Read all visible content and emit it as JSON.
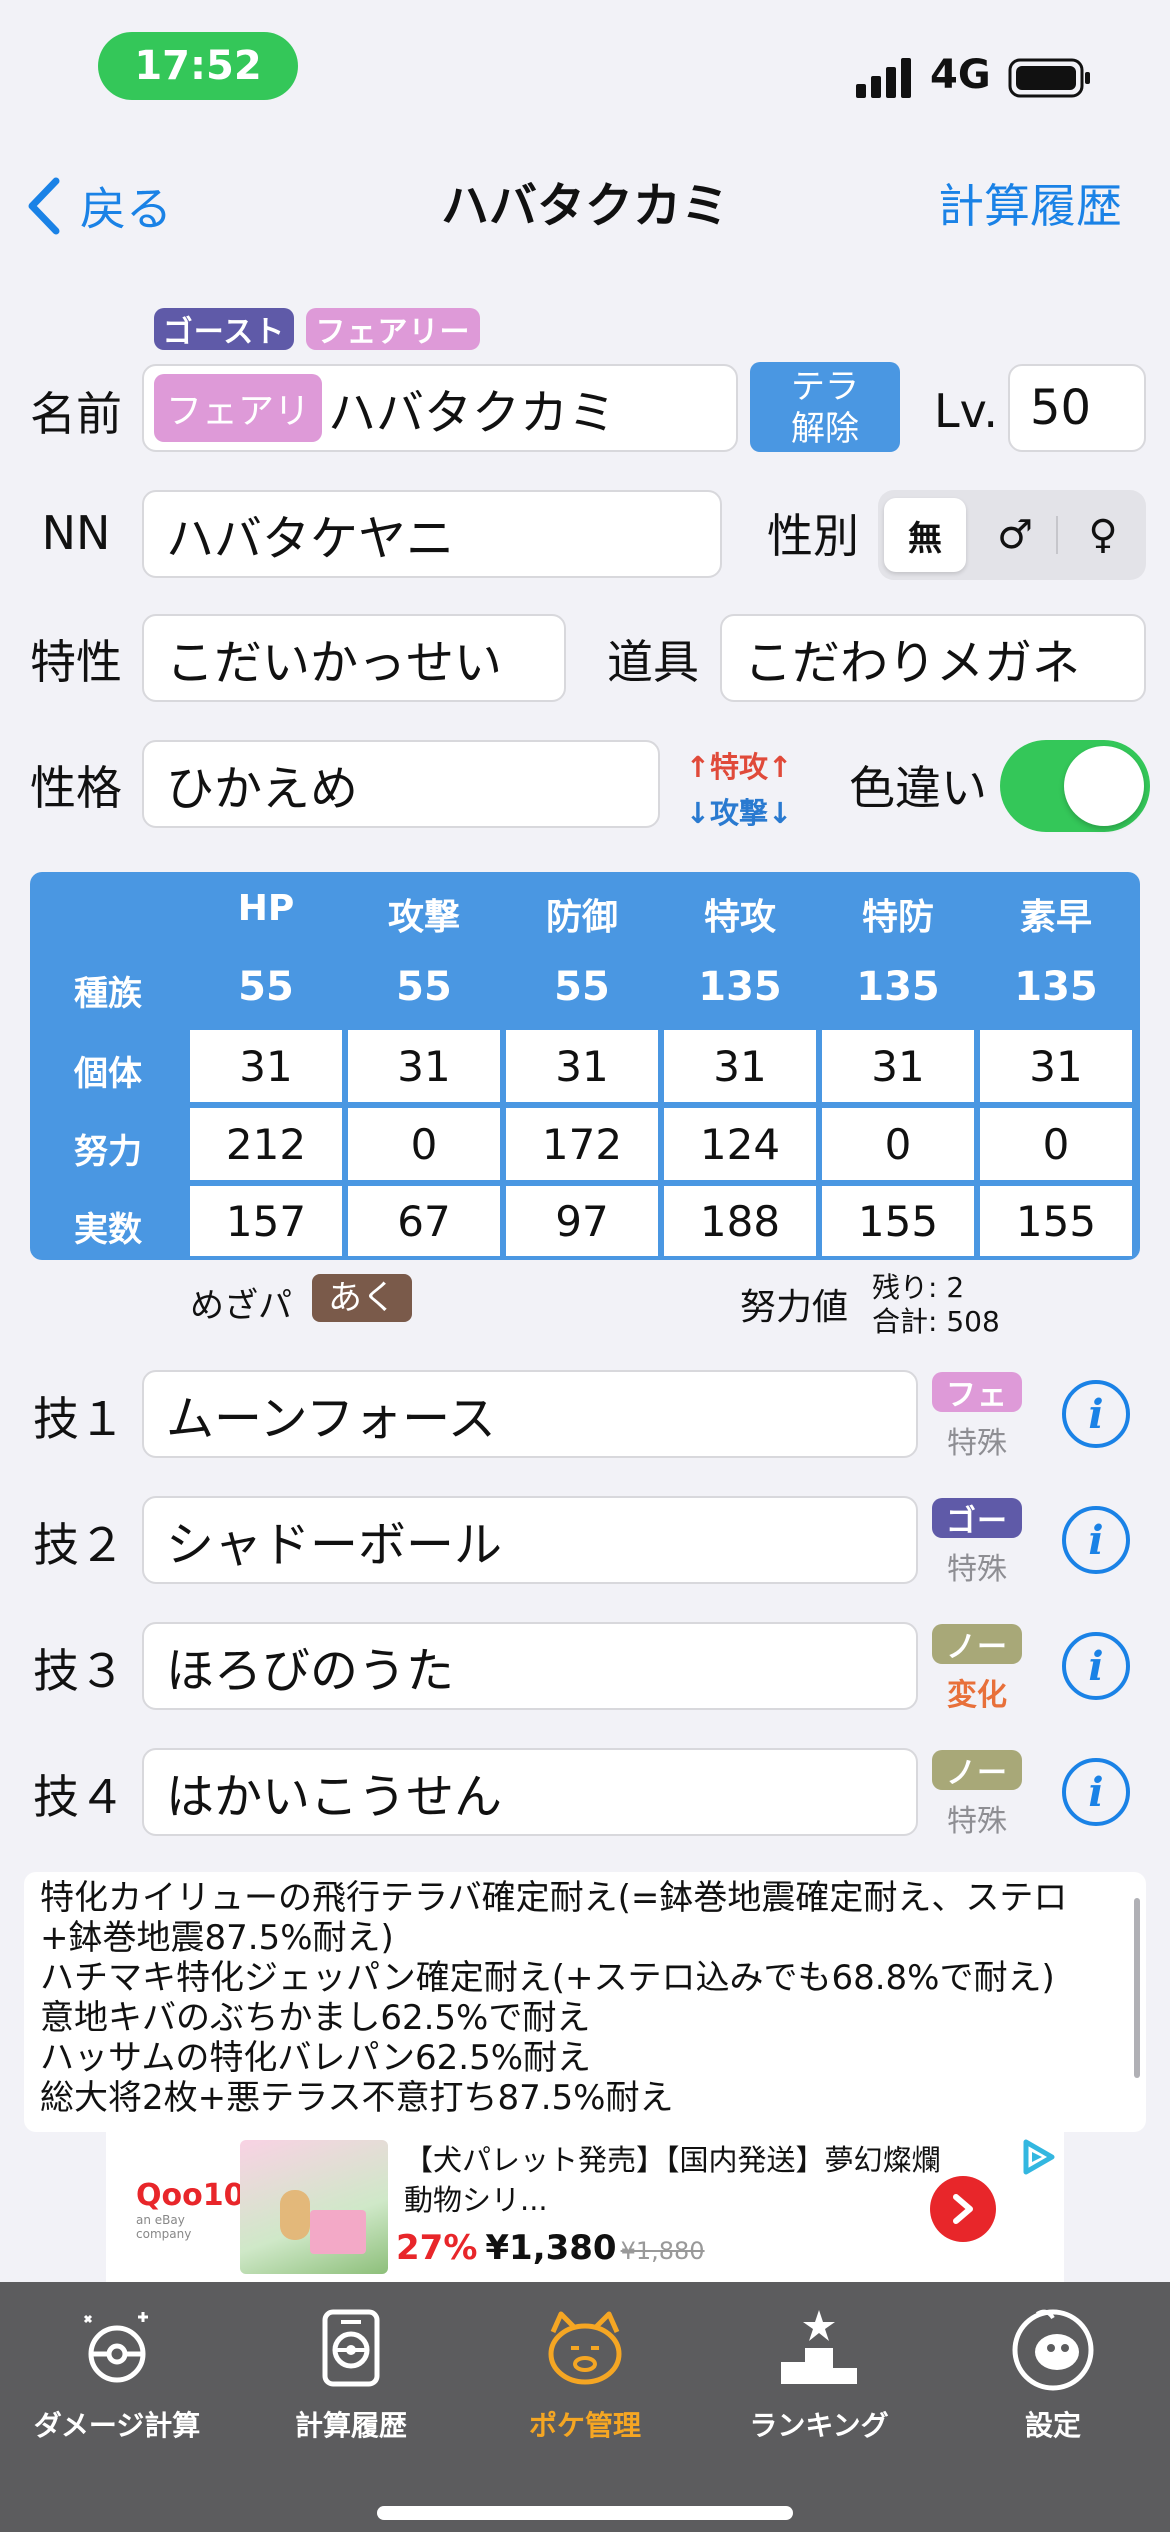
{
  "status_bar": {
    "time": "17:52",
    "network": "4G"
  },
  "nav": {
    "back_label": "戻る",
    "title": "ハバタクカミ",
    "right_label": "計算履歴"
  },
  "types": [
    {
      "name": "ゴースト",
      "color": "#5f5aa8"
    },
    {
      "name": "フェアリー",
      "color": "#de9ad8"
    }
  ],
  "form": {
    "name_label": "名前",
    "tera_badge": "フェアリ",
    "name_value": "ハバタクカミ",
    "tera_button_line1": "テラ",
    "tera_button_line2": "解除",
    "level_label": "Lv.",
    "level_value": "50",
    "nickname_label": "NN",
    "nickname_value": "ハバタケヤニ",
    "gender_label": "性別",
    "gender_options": [
      "無",
      "♂",
      "♀"
    ],
    "gender_selected": "無",
    "ability_label": "特性",
    "ability_value": "こだいかっせい",
    "item_label": "道具",
    "item_value": "こだわりメガネ",
    "nature_label": "性格",
    "nature_value": "ひかえめ",
    "nature_up": "↑特攻↑",
    "nature_down": "↓攻撃↓",
    "shiny_label": "色違い",
    "shiny_on": true
  },
  "stats": {
    "columns": [
      "HP",
      "攻撃",
      "防御",
      "特攻",
      "特防",
      "素早"
    ],
    "rows": [
      {
        "label": "種族",
        "values": [
          "55",
          "55",
          "55",
          "135",
          "135",
          "135"
        ]
      },
      {
        "label": "個体",
        "values": [
          "31",
          "31",
          "31",
          "31",
          "31",
          "31"
        ]
      },
      {
        "label": "努力",
        "values": [
          "212",
          "0",
          "172",
          "124",
          "0",
          "0"
        ]
      },
      {
        "label": "実数",
        "values": [
          "157",
          "67",
          "97",
          "188",
          "155",
          "155"
        ]
      }
    ]
  },
  "hidden_power": {
    "label": "めざパ",
    "type": "あく",
    "color": "#7a5a4a"
  },
  "ev_summary": {
    "label": "努力値",
    "remaining": "残り: 2",
    "total": "合計: 508"
  },
  "moves": [
    {
      "label": "技１",
      "name": "ムーンフォース",
      "type": "フェ",
      "type_color": "#de9ad8",
      "category": "特殊",
      "category_color": "#8e8e93"
    },
    {
      "label": "技２",
      "name": "シャドーボール",
      "type": "ゴー",
      "type_color": "#5f5aa8",
      "category": "特殊",
      "category_color": "#8e8e93"
    },
    {
      "label": "技３",
      "name": "ほろびのうた",
      "type": "ノー",
      "type_color": "#a8a878",
      "category": "変化",
      "category_color": "#e8703a"
    },
    {
      "label": "技４",
      "name": "はかいこうせん",
      "type": "ノー",
      "type_color": "#a8a878",
      "category": "特殊",
      "category_color": "#8e8e93"
    }
  ],
  "memo_lines": [
    "特化カイリューの飛行テラバ確定耐え(=鉢巻地震確定耐え、ステロ",
    "+鉢巻地震87.5%耐え)",
    "ハチマキ特化ジェッパン確定耐え(+ステロ込みでも68.8%で耐え)",
    "意地キバのぶちかまし62.5%で耐え",
    "ハッサムの特化バレパン62.5%耐え",
    "総大将2枚+悪テラス不意打ち87.5%耐え"
  ],
  "ad": {
    "brand": "Qoo10",
    "brand_sub": "an eBay company",
    "title": "【犬パレット発売】【国内発送】夢幻燦爛動物シリ...",
    "discount": "27%",
    "price": "¥1,380",
    "old_price": "¥1,880"
  },
  "tabs": [
    {
      "label": "ダメージ計算",
      "active": false
    },
    {
      "label": "計算履歴",
      "active": false
    },
    {
      "label": "ポケ管理",
      "active": true
    },
    {
      "label": "ランキング",
      "active": false
    },
    {
      "label": "設定",
      "active": false
    }
  ],
  "colors": {
    "accent": "#1a82e6",
    "active_tab": "#f5a623",
    "switch_on": "#34c759",
    "stats_bg": "#4a97e2",
    "tera_button": "#4a97e2"
  }
}
